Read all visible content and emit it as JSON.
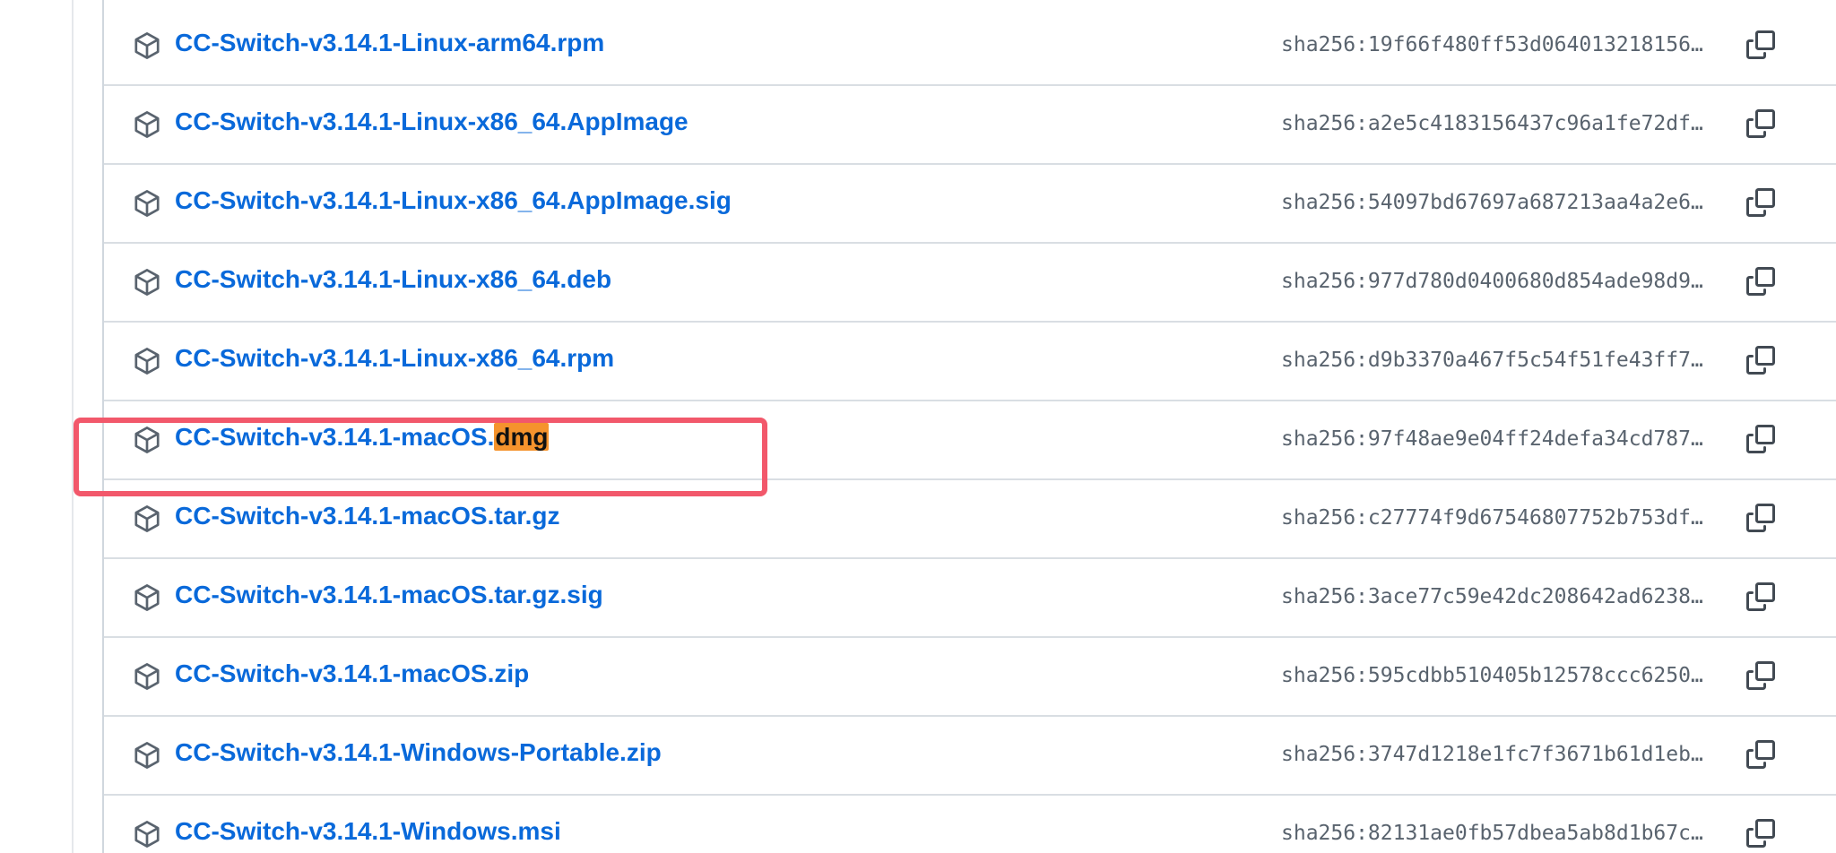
{
  "assets": [
    {
      "name": "CC-Switch-v3.14.1-Linux-arm64.rpm",
      "name_plain": "CC-Switch-v3.14.1-Linux-arm64.rpm",
      "name_highlight": "",
      "digest": "sha256:19f66f480ff53d064013218156…"
    },
    {
      "name": "CC-Switch-v3.14.1-Linux-x86_64.AppImage",
      "name_plain": "CC-Switch-v3.14.1-Linux-x86_64.AppImage",
      "name_highlight": "",
      "digest": "sha256:a2e5c4183156437c96a1fe72df…"
    },
    {
      "name": "CC-Switch-v3.14.1-Linux-x86_64.AppImage.sig",
      "name_plain": "CC-Switch-v3.14.1-Linux-x86_64.AppImage.sig",
      "name_highlight": "",
      "digest": "sha256:54097bd67697a687213aa4a2e6…"
    },
    {
      "name": "CC-Switch-v3.14.1-Linux-x86_64.deb",
      "name_plain": "CC-Switch-v3.14.1-Linux-x86_64.deb",
      "name_highlight": "",
      "digest": "sha256:977d780d0400680d854ade98d9…"
    },
    {
      "name": "CC-Switch-v3.14.1-Linux-x86_64.rpm",
      "name_plain": "CC-Switch-v3.14.1-Linux-x86_64.rpm",
      "name_highlight": "",
      "digest": "sha256:d9b3370a467f5c54f51fe43ff7…"
    },
    {
      "name": "CC-Switch-v3.14.1-macOS.dmg",
      "name_plain": "CC-Switch-v3.14.1-macOS.",
      "name_highlight": "dmg",
      "digest": "sha256:97f48ae9e04ff24defa34cd787…"
    },
    {
      "name": "CC-Switch-v3.14.1-macOS.tar.gz",
      "name_plain": "CC-Switch-v3.14.1-macOS.tar.gz",
      "name_highlight": "",
      "digest": "sha256:c27774f9d67546807752b753df…"
    },
    {
      "name": "CC-Switch-v3.14.1-macOS.tar.gz.sig",
      "name_plain": "CC-Switch-v3.14.1-macOS.tar.gz.sig",
      "name_highlight": "",
      "digest": "sha256:3ace77c59e42dc208642ad6238…"
    },
    {
      "name": "CC-Switch-v3.14.1-macOS.zip",
      "name_plain": "CC-Switch-v3.14.1-macOS.zip",
      "name_highlight": "",
      "digest": "sha256:595cdbb510405b12578ccc6250…"
    },
    {
      "name": "CC-Switch-v3.14.1-Windows-Portable.zip",
      "name_plain": "CC-Switch-v3.14.1-Windows-Portable.zip",
      "name_highlight": "",
      "digest": "sha256:3747d1218e1fc7f3671b61d1eb…"
    },
    {
      "name": "CC-Switch-v3.14.1-Windows.msi",
      "name_plain": "CC-Switch-v3.14.1-Windows.msi",
      "name_highlight": "",
      "digest": "sha256:82131ae0fb57dbea5ab8d1b67c…"
    }
  ],
  "icons": {
    "row_icon": "package-icon",
    "copy_icon": "copy-icon"
  },
  "colors": {
    "link": "#0969da",
    "search_highlight": "#f5932d",
    "callout_border": "#f2586b",
    "digest_text": "#59636e"
  }
}
